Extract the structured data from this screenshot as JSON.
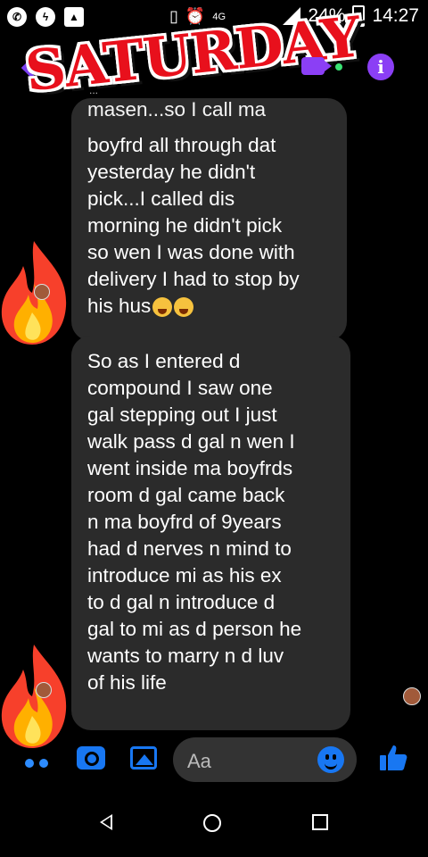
{
  "status_bar": {
    "signal_label": "4G",
    "battery": "24%",
    "time": "14:27"
  },
  "header": {
    "sticker_text": "SATURDAY",
    "contact_status": "..."
  },
  "messages": [
    {
      "clipped_top": "masen...so I call ma",
      "text": "boyfrd all through dat\nyesterday he didn't\npick...I called dis\nmorning he didn't pick\nso wen I was done with\ndelivery I had to stop by\nhis hus"
    },
    {
      "text": "So as I entered d\ncompound I saw one\ngal stepping out I just\nwalk pass d gal n wen I\nwent inside ma boyfrds\nroom d gal came back\nn ma boyfrd of 9years\nhad d nerves n mind to\nintroduce mi as his ex\nto d gal n introduce d\ngal to mi as d person he\nwants to marry n d luv\nof his life"
    }
  ],
  "composer": {
    "placeholder": "Aa"
  },
  "colors": {
    "accent": "#8b3ff5",
    "messenger_blue": "#1877f2",
    "bubble": "#2b2b2b",
    "sticker_red": "#e8101c"
  },
  "icons": [
    "whatsapp-icon",
    "messenger-icon",
    "gallery-icon",
    "vibrate-icon",
    "alarm-icon",
    "signal-icon",
    "battery-icon",
    "back-arrow-icon",
    "video-call-icon",
    "info-icon",
    "fire-icon",
    "more-dots-icon",
    "camera-icon",
    "image-icon",
    "emoji-icon",
    "like-icon",
    "nav-back-icon",
    "nav-home-icon",
    "nav-recents-icon"
  ]
}
